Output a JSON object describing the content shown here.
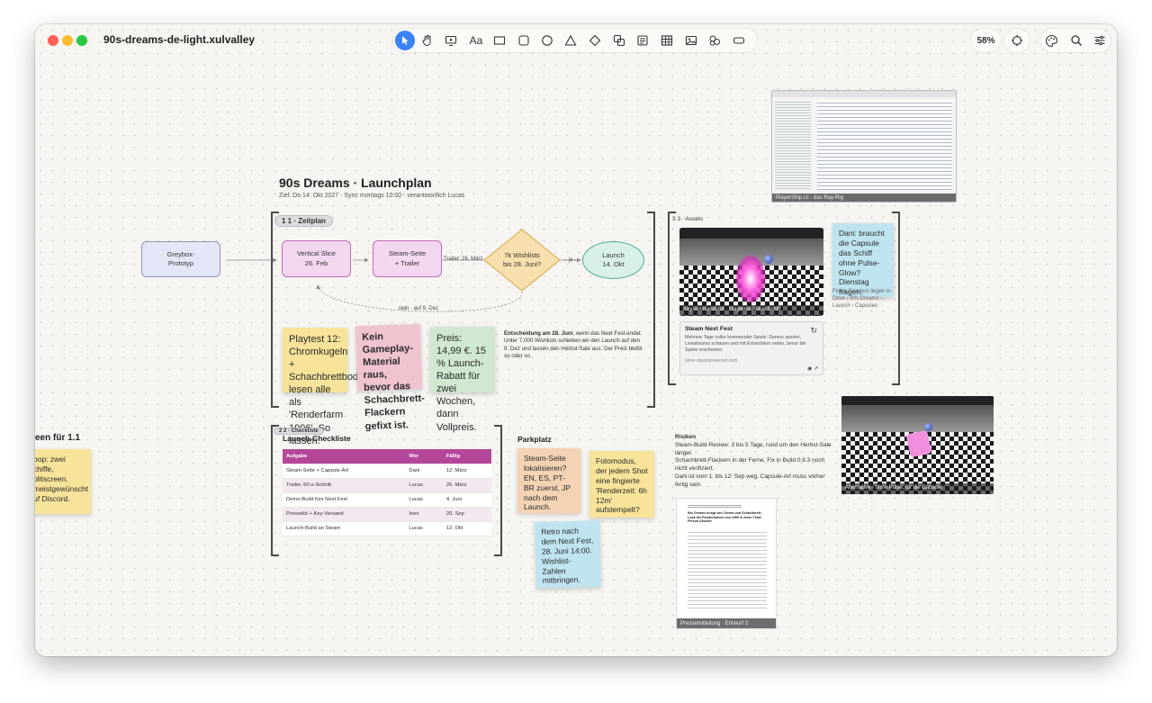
{
  "window": {
    "title": "90s-dreams-de-light.xulvalley"
  },
  "toolbar": {
    "tools": [
      "select-tool",
      "hand-tool",
      "present-tool",
      "text-tool",
      "rectangle-tool",
      "rounded-rect-tool",
      "circle-tool",
      "triangle-tool",
      "diamond-tool",
      "group-tool",
      "card-tool",
      "table-tool",
      "image-tool",
      "shapes-tool",
      "button-tool"
    ],
    "text_tool_label": "Aa",
    "zoom": "58%"
  },
  "colors": {
    "accent": "#3b82f6",
    "table_header": "#b5479a",
    "node_pink": "#f3d7f0",
    "node_blue": "#e3e6f7",
    "diamond": "#f7dfae",
    "launch": "#d8f0e8"
  },
  "plan": {
    "title": "90s Dreams · Launchplan",
    "subtitle": "Ziel: Do 14. Okt 2027 · Sync montags 10:00 · verantwortlich Lucas",
    "timeline_tag": "1 1 · Zeitplan",
    "nodes": {
      "greybox": "Greybox-\nPrototyp",
      "vertical_slice": "Vertical Slice\n26. Feb",
      "steam_page": "Steam-Seite\n+ Trailer",
      "trailer_label": "Trailer: 26. März",
      "wishlists": "7k Wishlists\nbis 28. Juni?",
      "yes_label": "- ja -",
      "launch": "Launch\n14. Okt",
      "no_label": "nein · auf 9. Dez"
    },
    "stickies": {
      "playtest": "Playtest 12: Chromkugeln + Schachbrettboden lesen alle als 'Renderfarm 1996'. So lassen.",
      "no_gameplay": "Kein Gameplay-Material raus, bevor das Schachbrett-Flackern gefixt ist.",
      "price": "Preis: 14,99 €. 15 % Launch-Rabatt für zwei Wochen, dann Vollpreis."
    },
    "decision": {
      "bold": "Entscheidung am 28. Juni",
      "rest": ", wenn das Next Fest endet. Unter 7.000 Wishlists schieben wir den Launch auf den 9. Dez und lassen den Herbst-Sale aus. Der Preis bleibt so oder so."
    }
  },
  "left_partial": {
    "heading": "een für 1.1",
    "sticky": "oop: zwei\nchiffe,\nplitscreen.\nmeistgewünscht\nuf Discord."
  },
  "checklist": {
    "tag": "2 2 · Checkliste",
    "title": "Launch-Checkliste",
    "headers": [
      "Aufgabe",
      "Wer",
      "Fällig"
    ],
    "rows": [
      [
        "Steam-Seite + Capsule-Art",
        "Dani",
        "12. März"
      ],
      [
        "Trailer, 60-s-Schnitt",
        "Lucas",
        "26. März"
      ],
      [
        "Demo-Build fürs Next Fest",
        "Lucas",
        "4. Juni"
      ],
      [
        "Pressekit + Key-Versand",
        "Ines",
        "20. Sep"
      ],
      [
        "Launch-Build an Steam",
        "Lucas",
        "12. Okt"
      ]
    ]
  },
  "parking": {
    "title": "Parkplatz",
    "stickies": {
      "localize": "Steam-Seite lokalisieren? EN, ES, PT-BR zuerst, JP nach dem Launch.",
      "photomode": "Fotomodus, der jedem Shot eine fingierte 'Renderzeit: 6h 12m' aufstempelt?",
      "retro": "Retro nach dem Next Fest, 28. Juni 14:00. Wishlist-Zahlen mitbringen."
    }
  },
  "assets": {
    "tag": "3 3 · Assets",
    "key_art_caption": "Key-Art-Kandidat · Magenta-Pulse-Schiff",
    "dani_sticky": "Dani: braucht die Capsule das Schiff ohne Pulse-Glow? Dienstag fragen.",
    "renders_note": "Finale Renders liegen in Drive › 90s Dreams › Launch › Capsules",
    "link_card": {
      "title": "Steam Next Fest",
      "body": "Mehrere Tage voller kommender Spiele: Demos spielen, Livestreams schauen und mit Entwicklern reden, bevor die Spiele erscheinen.",
      "url": "store.steampowered.com"
    },
    "code_caption": "PlayerShip.cs · das Ray-Rig",
    "alt_caption": "Alternative · ohne Pulse, für die Capsule"
  },
  "risks": {
    "title": "Risiken",
    "lines": [
      "Steam-Build-Review: 3 bis 5 Tage, rund um den Herbst-Sale länger.",
      "Schachbrett-Flackern in der Ferne, Fix in Build 0.9.3 noch nicht verifiziert.",
      "Dani ist vom 1. bis 12. Sep weg, Capsule-Art muss vorher fertig sein."
    ]
  },
  "press": {
    "caption": "Pressemitteilung · Entwurf 2",
    "headline": "90s Dreams bringt den Chrom-und-Schachbrett-Look der Renderfarmen von 1996 in einen Third-Person-Shooter"
  }
}
